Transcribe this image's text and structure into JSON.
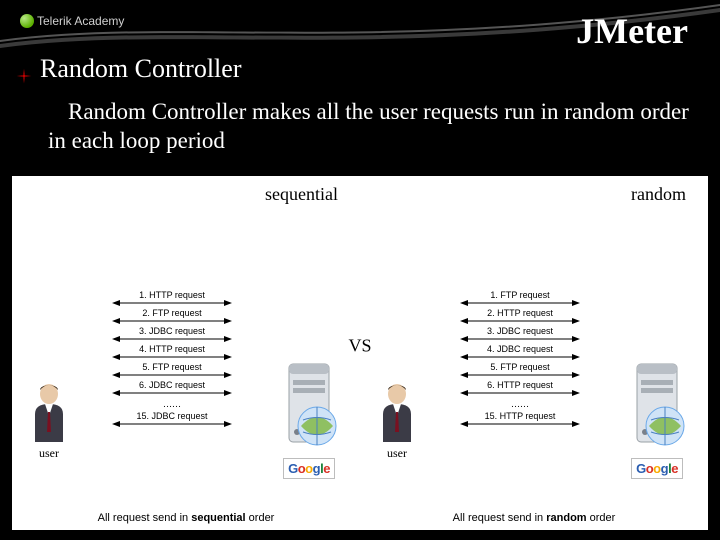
{
  "logo_text": "Telerik Academy",
  "title": "JMeter",
  "heading": "Random Controller",
  "bullet": "Random Controller makes all the user requests run in random order in each loop period",
  "vs": "VS",
  "panels": {
    "left": {
      "mode": "sequential",
      "caption_prefix": "All request send in ",
      "caption_bold": "sequential",
      "caption_suffix": " order",
      "requests": [
        "1. HTTP request",
        "2. FTP request",
        "3. JDBC request",
        "4. HTTP request",
        "5. FTP request",
        "6. JDBC request"
      ],
      "last": "15. JDBC request",
      "user_label": "user"
    },
    "right": {
      "mode": "random",
      "caption_prefix": "All request send in ",
      "caption_bold": "random",
      "caption_suffix": "  order",
      "requests": [
        "1. FTP request",
        "2. HTTP request",
        "3. JDBC request",
        "4. JDBC request",
        "5. FTP request",
        "6. HTTP request"
      ],
      "last": "15. HTTP request",
      "user_label": "user"
    }
  },
  "google": "Google"
}
